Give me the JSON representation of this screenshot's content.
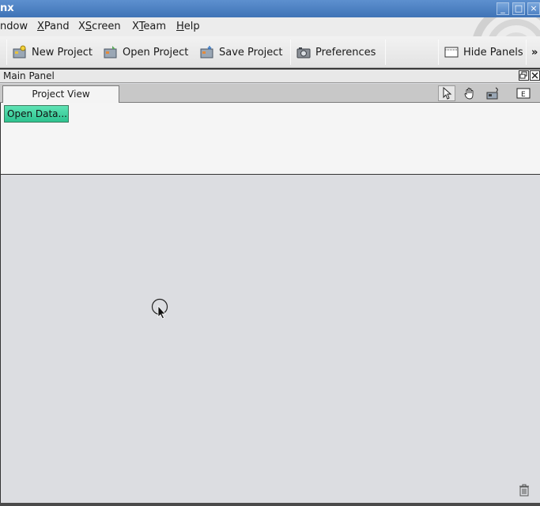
{
  "window": {
    "title": "nx",
    "buttons": [
      "_",
      "□",
      "×"
    ]
  },
  "menu": {
    "items": [
      {
        "pre": "",
        "mnemonic": "",
        "post": "ndow"
      },
      {
        "pre": "",
        "mnemonic": "X",
        "post": "Pand"
      },
      {
        "pre": "X",
        "mnemonic": "S",
        "post": "creen"
      },
      {
        "pre": "X",
        "mnemonic": "T",
        "post": "eam"
      },
      {
        "pre": "",
        "mnemonic": "H",
        "post": "elp"
      }
    ]
  },
  "toolbar": {
    "new_project": "New Project",
    "open_project": "Open Project",
    "save_project": "Save Project",
    "preferences": "Preferences",
    "hide_panels": "Hide Panels",
    "overflow": "»"
  },
  "panel": {
    "title": "Main Panel",
    "tab": "Project View",
    "open_data": "Open Data..."
  },
  "colors": {
    "titlebar": "#4a80c2",
    "open_data_button": "#3fd4a0"
  }
}
